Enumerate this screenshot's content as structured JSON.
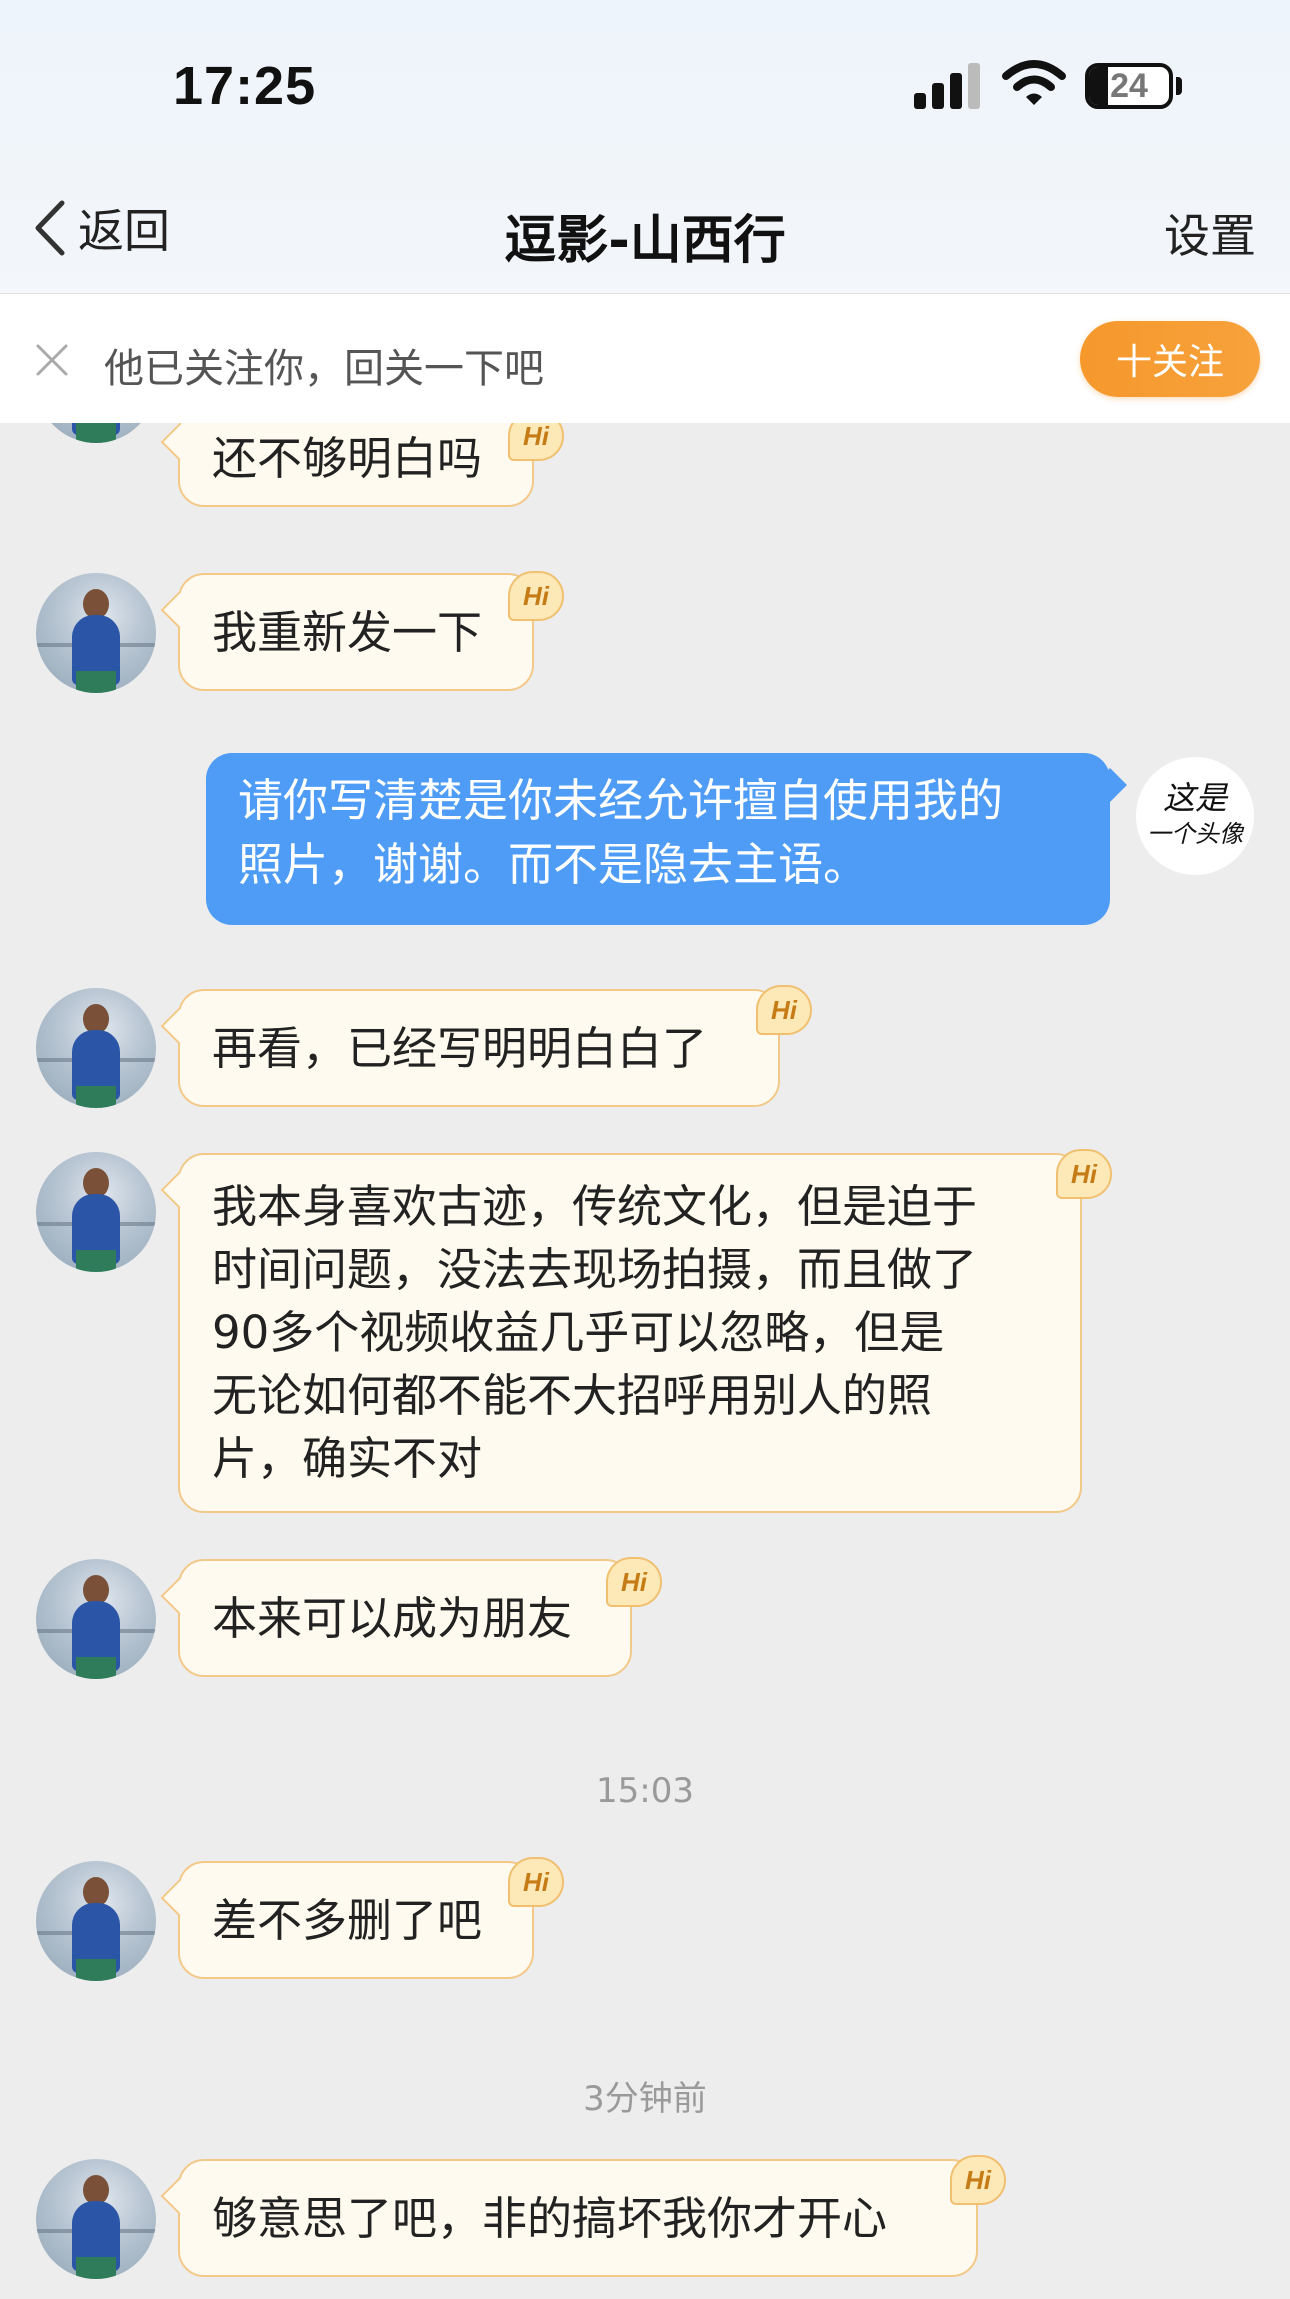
{
  "status_bar": {
    "time": "17:25",
    "battery": "24",
    "signal_icon": "cell-signal-icon",
    "wifi_icon": "wifi-icon"
  },
  "nav": {
    "back_label": "返回",
    "title": "逗影-山西行",
    "settings_label": "设置"
  },
  "follow_prompt": {
    "text": "他已关注你，回关一下吧",
    "button_label": "十关注",
    "close_icon": "close-icon"
  },
  "messages": [
    {
      "from": "them",
      "text": "还不够明白吗",
      "badge": "Hi"
    },
    {
      "from": "them",
      "text": "我重新发一下",
      "badge": "Hi"
    },
    {
      "from": "me",
      "lines": [
        "请你写清楚是你未经允许擅自使用我的",
        "照片，谢谢。而不是隐去主语。"
      ],
      "avatar_lines": [
        "这是",
        "一个头像"
      ]
    },
    {
      "from": "them",
      "text": "再看，已经写明明白白了",
      "badge": "Hi"
    },
    {
      "from": "them",
      "lines": [
        "我本身喜欢古迹，传统文化，但是迫于",
        "时间问题，没法去现场拍摄，而且做了",
        "90多个视频收益几乎可以忽略，但是",
        "无论如何都不能不大招呼用别人的照",
        "片，确实不对"
      ],
      "badge": "Hi"
    },
    {
      "from": "them",
      "text": "本来可以成为朋友",
      "badge": "Hi"
    },
    {
      "from": "time",
      "text": "15:03"
    },
    {
      "from": "them",
      "text": "差不多删了吧",
      "badge": "Hi"
    },
    {
      "from": "time",
      "text": "3分钟前"
    },
    {
      "from": "them",
      "text": "够意思了吧，非的搞坏我你才开心",
      "badge": "Hi"
    }
  ],
  "colors": {
    "outgoing_bubble": "#4e9cf5",
    "incoming_bubble": "#fffaef",
    "follow_button": "#f6982c",
    "background": "#ededed"
  }
}
